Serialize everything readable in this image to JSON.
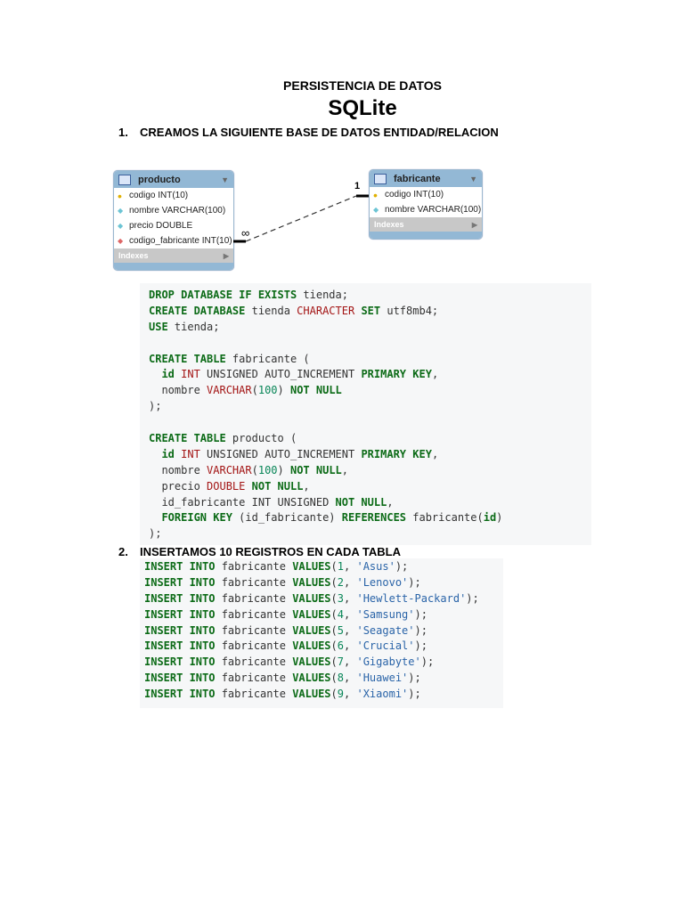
{
  "title": "PERSISTENCIA  DE DATOS",
  "subtitle": "SQLite",
  "sections": [
    {
      "num": "1.",
      "text": "CREAMOS LA SIGUIENTE BASE DE DATOS ENTIDAD/RELACION"
    },
    {
      "num": "2.",
      "text": "INSERTAMOS 10 REGISTROS EN CADA TABLA"
    }
  ],
  "diagram": {
    "producto": {
      "name": "producto",
      "rows": [
        {
          "icon": "key",
          "text": "codigo INT(10)"
        },
        {
          "icon": "diamond",
          "text": "nombre VARCHAR(100)"
        },
        {
          "icon": "diamond",
          "text": "precio DOUBLE"
        },
        {
          "icon": "fk-diamond",
          "text": "codigo_fabricante INT(10)"
        }
      ],
      "indexes": "Indexes"
    },
    "fabricante": {
      "name": "fabricante",
      "rows": [
        {
          "icon": "key",
          "text": "codigo INT(10)"
        },
        {
          "icon": "diamond",
          "text": "nombre VARCHAR(100)"
        }
      ],
      "indexes": "Indexes"
    },
    "rel_many": "∞",
    "rel_one": "1"
  },
  "code1": [
    [
      [
        "DROP DATABASE IF EXISTS",
        "k"
      ],
      [
        " tienda;",
        "p"
      ]
    ],
    [
      [
        "CREATE DATABASE",
        "k"
      ],
      [
        " tienda ",
        "p"
      ],
      [
        "CHARACTER",
        "t"
      ],
      [
        " ",
        "p"
      ],
      [
        "SET",
        "k"
      ],
      [
        " utf8mb4;",
        "p"
      ]
    ],
    [
      [
        "USE",
        "k"
      ],
      [
        " tienda;",
        "p"
      ]
    ],
    [],
    [
      [
        "CREATE TABLE",
        "k"
      ],
      [
        " fabricante (",
        "p"
      ]
    ],
    [
      [
        "  ",
        "p"
      ],
      [
        "id",
        "k"
      ],
      [
        " ",
        "p"
      ],
      [
        "INT",
        "t"
      ],
      [
        " UNSIGNED AUTO_INCREMENT ",
        "p"
      ],
      [
        "PRIMARY KEY",
        "k"
      ],
      [
        ",",
        "p"
      ]
    ],
    [
      [
        "  nombre ",
        "p"
      ],
      [
        "VARCHAR",
        "t"
      ],
      [
        "(",
        "p"
      ],
      [
        "100",
        "n"
      ],
      [
        ") ",
        "p"
      ],
      [
        "NOT NULL",
        "k"
      ]
    ],
    [
      [
        ");",
        "p"
      ]
    ],
    [],
    [
      [
        "CREATE TABLE",
        "k"
      ],
      [
        " producto (",
        "p"
      ]
    ],
    [
      [
        "  ",
        "p"
      ],
      [
        "id",
        "k"
      ],
      [
        " ",
        "p"
      ],
      [
        "INT",
        "t"
      ],
      [
        " UNSIGNED AUTO_INCREMENT ",
        "p"
      ],
      [
        "PRIMARY KEY",
        "k"
      ],
      [
        ",",
        "p"
      ]
    ],
    [
      [
        "  nombre ",
        "p"
      ],
      [
        "VARCHAR",
        "t"
      ],
      [
        "(",
        "p"
      ],
      [
        "100",
        "n"
      ],
      [
        ") ",
        "p"
      ],
      [
        "NOT NULL",
        "k"
      ],
      [
        ",",
        "p"
      ]
    ],
    [
      [
        "  precio ",
        "p"
      ],
      [
        "DOUBLE",
        "t"
      ],
      [
        " ",
        "p"
      ],
      [
        "NOT NULL",
        "k"
      ],
      [
        ",",
        "p"
      ]
    ],
    [
      [
        "  id_fabricante INT UNSIGNED ",
        "p"
      ],
      [
        "NOT NULL",
        "k"
      ],
      [
        ",",
        "p"
      ]
    ],
    [
      [
        "  ",
        "p"
      ],
      [
        "FOREIGN KEY",
        "k"
      ],
      [
        " (id_fabricante) ",
        "p"
      ],
      [
        "REFERENCES",
        "k"
      ],
      [
        " fabricante(",
        "p"
      ],
      [
        "id",
        "k"
      ],
      [
        ")",
        "p"
      ]
    ],
    [
      [
        ");",
        "p"
      ]
    ]
  ],
  "code2": [
    [
      [
        "INSERT INTO",
        "k"
      ],
      [
        " fabricante ",
        "p"
      ],
      [
        "VALUES",
        "k"
      ],
      [
        "(",
        "p"
      ],
      [
        "1",
        "n"
      ],
      [
        ", ",
        "p"
      ],
      [
        "'Asus'",
        "s"
      ],
      [
        ");",
        "p"
      ]
    ],
    [
      [
        "INSERT INTO",
        "k"
      ],
      [
        " fabricante ",
        "p"
      ],
      [
        "VALUES",
        "k"
      ],
      [
        "(",
        "p"
      ],
      [
        "2",
        "n"
      ],
      [
        ", ",
        "p"
      ],
      [
        "'Lenovo'",
        "s"
      ],
      [
        ");",
        "p"
      ]
    ],
    [
      [
        "INSERT INTO",
        "k"
      ],
      [
        " fabricante ",
        "p"
      ],
      [
        "VALUES",
        "k"
      ],
      [
        "(",
        "p"
      ],
      [
        "3",
        "n"
      ],
      [
        ", ",
        "p"
      ],
      [
        "'Hewlett-Packard'",
        "s"
      ],
      [
        ");",
        "p"
      ]
    ],
    [
      [
        "INSERT INTO",
        "k"
      ],
      [
        " fabricante ",
        "p"
      ],
      [
        "VALUES",
        "k"
      ],
      [
        "(",
        "p"
      ],
      [
        "4",
        "n"
      ],
      [
        ", ",
        "p"
      ],
      [
        "'Samsung'",
        "s"
      ],
      [
        ");",
        "p"
      ]
    ],
    [
      [
        "INSERT INTO",
        "k"
      ],
      [
        " fabricante ",
        "p"
      ],
      [
        "VALUES",
        "k"
      ],
      [
        "(",
        "p"
      ],
      [
        "5",
        "n"
      ],
      [
        ", ",
        "p"
      ],
      [
        "'Seagate'",
        "s"
      ],
      [
        ");",
        "p"
      ]
    ],
    [
      [
        "INSERT INTO",
        "k"
      ],
      [
        " fabricante ",
        "p"
      ],
      [
        "VALUES",
        "k"
      ],
      [
        "(",
        "p"
      ],
      [
        "6",
        "n"
      ],
      [
        ", ",
        "p"
      ],
      [
        "'Crucial'",
        "s"
      ],
      [
        ");",
        "p"
      ]
    ],
    [
      [
        "INSERT INTO",
        "k"
      ],
      [
        " fabricante ",
        "p"
      ],
      [
        "VALUES",
        "k"
      ],
      [
        "(",
        "p"
      ],
      [
        "7",
        "n"
      ],
      [
        ", ",
        "p"
      ],
      [
        "'Gigabyte'",
        "s"
      ],
      [
        ");",
        "p"
      ]
    ],
    [
      [
        "INSERT INTO",
        "k"
      ],
      [
        " fabricante ",
        "p"
      ],
      [
        "VALUES",
        "k"
      ],
      [
        "(",
        "p"
      ],
      [
        "8",
        "n"
      ],
      [
        ", ",
        "p"
      ],
      [
        "'Huawei'",
        "s"
      ],
      [
        ");",
        "p"
      ]
    ],
    [
      [
        "INSERT INTO",
        "k"
      ],
      [
        " fabricante ",
        "p"
      ],
      [
        "VALUES",
        "k"
      ],
      [
        "(",
        "p"
      ],
      [
        "9",
        "n"
      ],
      [
        ", ",
        "p"
      ],
      [
        "'Xiaomi'",
        "s"
      ],
      [
        ");",
        "p"
      ]
    ]
  ]
}
